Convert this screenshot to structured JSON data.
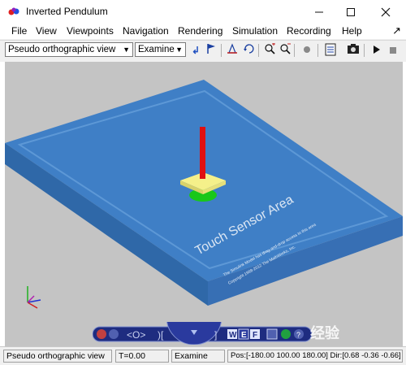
{
  "window": {
    "title": "Inverted Pendulum",
    "minimize_icon": "minimize-icon",
    "maximize_icon": "maximize-icon",
    "close_icon": "close-icon"
  },
  "menu": {
    "items": [
      "File",
      "View",
      "Viewpoints",
      "Navigation",
      "Rendering",
      "Simulation",
      "Recording",
      "Help"
    ]
  },
  "toolbar": {
    "viewpoint_select": "Pseudo orthographic view",
    "mode_select": "Examine"
  },
  "scene": {
    "sensor_area_label": "Touch Sensor Area",
    "fine_print_line1": "The Simulink Model has drag-and-drop access to this area",
    "fine_print_line2": "Copyright 1998-2012 The MathWorks, Inc."
  },
  "statusbar": {
    "view": "Pseudo orthographic view",
    "time": "T=0.00",
    "mode": "Examine",
    "position": "Pos:[-180.00 100.00 180.00] Dir:[0.68 -0.36 -0.66]"
  },
  "watermark": "经验",
  "colors": {
    "platform": "#3f7fc6",
    "pendulum_rod": "#e01010",
    "cart": "#f5f08a",
    "base": "#19c719"
  }
}
